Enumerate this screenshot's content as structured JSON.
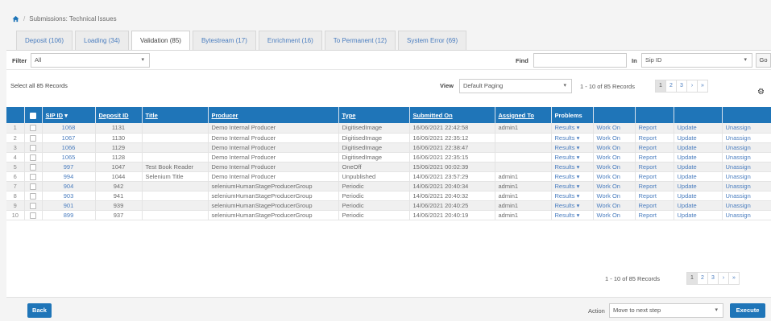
{
  "breadcrumb": {
    "current": "Submissions: Technical Issues",
    "separator": "/",
    "home_icon": "home-icon"
  },
  "tabs": [
    {
      "label": "Deposit (106)",
      "active": false
    },
    {
      "label": "Loading (34)",
      "active": false
    },
    {
      "label": "Validation (85)",
      "active": true
    },
    {
      "label": "Bytestream (17)",
      "active": false
    },
    {
      "label": "Enrichment (16)",
      "active": false
    },
    {
      "label": "To Permanent (12)",
      "active": false
    },
    {
      "label": "System Error (69)",
      "active": false
    }
  ],
  "filter": {
    "label": "Filter",
    "value": "All",
    "find_label": "Find",
    "find_value": "",
    "in_label": "In",
    "in_value": "Sip ID",
    "go_label": "Go"
  },
  "list": {
    "select_all": "Select all 85 Records",
    "view_label": "View",
    "view_value": "Default Paging",
    "range": "1 - 10 of 85 Records",
    "pages": [
      "1",
      "2",
      "3",
      "›",
      "»"
    ],
    "current_page": "1"
  },
  "table": {
    "columns": [
      "",
      "",
      "SIP ID",
      "Deposit ID",
      "Title",
      "Producer",
      "Type",
      "Submitted On",
      "Assigned To",
      "Problems",
      "",
      "",
      "",
      ""
    ],
    "sort_indicator": "▾",
    "rows": [
      {
        "n": "1",
        "sip": "1068",
        "deposit": "1131",
        "title": "",
        "producer": "Demo Internal Producer",
        "type": "DigitisedImage",
        "submitted": "16/06/2021 22:42:58",
        "assigned": "admin1"
      },
      {
        "n": "2",
        "sip": "1067",
        "deposit": "1130",
        "title": "",
        "producer": "Demo Internal Producer",
        "type": "DigitisedImage",
        "submitted": "16/06/2021 22:35:12",
        "assigned": ""
      },
      {
        "n": "3",
        "sip": "1066",
        "deposit": "1129",
        "title": "",
        "producer": "Demo Internal Producer",
        "type": "DigitisedImage",
        "submitted": "16/06/2021 22:38:47",
        "assigned": ""
      },
      {
        "n": "4",
        "sip": "1065",
        "deposit": "1128",
        "title": "",
        "producer": "Demo Internal Producer",
        "type": "DigitisedImage",
        "submitted": "16/06/2021 22:35:15",
        "assigned": ""
      },
      {
        "n": "5",
        "sip": "997",
        "deposit": "1047",
        "title": "Test Book Reader",
        "producer": "Demo Internal Producer",
        "type": "OneOff",
        "submitted": "15/06/2021 00:02:39",
        "assigned": ""
      },
      {
        "n": "6",
        "sip": "994",
        "deposit": "1044",
        "title": "Selenium Title",
        "producer": "Demo Internal Producer",
        "type": "Unpublished",
        "submitted": "14/06/2021 23:57:29",
        "assigned": "admin1"
      },
      {
        "n": "7",
        "sip": "904",
        "deposit": "942",
        "title": "",
        "producer": "seleniumHumanStageProducerGroup",
        "type": "Periodic",
        "submitted": "14/06/2021 20:40:34",
        "assigned": "admin1"
      },
      {
        "n": "8",
        "sip": "903",
        "deposit": "941",
        "title": "",
        "producer": "seleniumHumanStageProducerGroup",
        "type": "Periodic",
        "submitted": "14/06/2021 20:40:32",
        "assigned": "admin1"
      },
      {
        "n": "9",
        "sip": "901",
        "deposit": "939",
        "title": "",
        "producer": "seleniumHumanStageProducerGroup",
        "type": "Periodic",
        "submitted": "14/06/2021 20:40:25",
        "assigned": "admin1"
      },
      {
        "n": "10",
        "sip": "899",
        "deposit": "937",
        "title": "",
        "producer": "seleniumHumanStageProducerGroup",
        "type": "Periodic",
        "submitted": "14/06/2021 20:40:19",
        "assigned": "admin1"
      }
    ],
    "row_actions": {
      "results": "Results ▾",
      "work_on": "Work On",
      "report": "Report",
      "update": "Update",
      "unassign": "Unassign"
    }
  },
  "bottom": {
    "back_label": "Back",
    "action_label": "Action",
    "action_value": "Move to next step",
    "execute_label": "Execute"
  },
  "colors": {
    "header_blue": "#1f75b8",
    "link_blue": "#4a7dbf"
  }
}
